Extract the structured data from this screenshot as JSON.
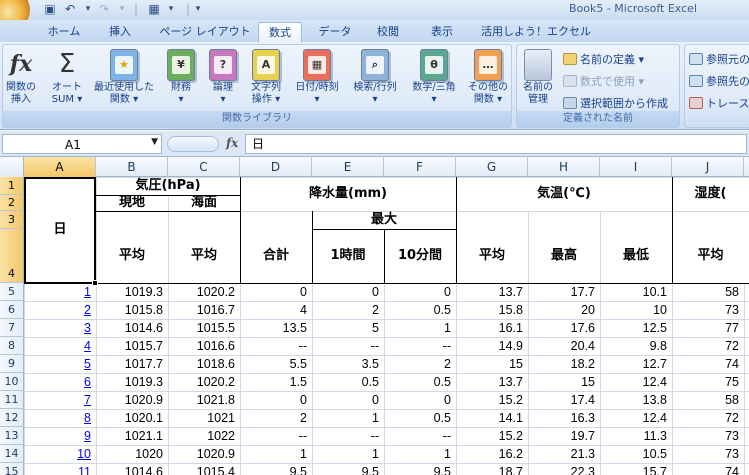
{
  "window": {
    "title": "Book5 - Microsoft Excel"
  },
  "tabs": [
    {
      "label": "ホーム"
    },
    {
      "label": "挿入"
    },
    {
      "label": "ページ レイアウト"
    },
    {
      "label": "数式"
    },
    {
      "label": "データ"
    },
    {
      "label": "校閲"
    },
    {
      "label": "表示"
    },
    {
      "label": "活用しよう！エクセル"
    }
  ],
  "ribbon": {
    "library": {
      "label": "関数ライブラリ",
      "buttons": [
        {
          "line1": "関数の",
          "line2": "挿入",
          "icon": "fx-icon"
        },
        {
          "line1": "オート",
          "line2": "SUM ▾",
          "icon": "sigma-icon"
        },
        {
          "line1": "最近使用した",
          "line2": "関数 ▾",
          "icon": "star-book-icon"
        },
        {
          "line1": "財務",
          "line2": "▾",
          "icon": "finance-book-icon"
        },
        {
          "line1": "論理",
          "line2": "▾",
          "icon": "logic-book-icon"
        },
        {
          "line1": "文字列",
          "line2": "操作 ▾",
          "icon": "text-book-icon"
        },
        {
          "line1": "日付/時刻",
          "line2": "▾",
          "icon": "datetime-book-icon"
        },
        {
          "line1": "検索/行列",
          "line2": "▾",
          "icon": "lookup-book-icon"
        },
        {
          "line1": "数学/三角",
          "line2": "▾",
          "icon": "math-book-icon"
        },
        {
          "line1": "その他の",
          "line2": "関数 ▾",
          "icon": "more-book-icon"
        }
      ]
    },
    "names": {
      "label": "定義された名前",
      "manager_line1": "名前の",
      "manager_line2": "管理",
      "define_name": "名前の定義 ▾",
      "use_in_formula": "数式で使用 ▾",
      "create_from_selection": "選択範囲から作成"
    },
    "audit": {
      "trace_precedents": "参照元の",
      "trace_dependents": "参照先の",
      "remove_arrows": "トレース"
    }
  },
  "formula_bar": {
    "name_box": "A1",
    "fx": "fx",
    "content": "日"
  },
  "columns": [
    "A",
    "B",
    "C",
    "D",
    "E",
    "F",
    "G",
    "H",
    "I",
    "J"
  ],
  "rows": [
    "1",
    "2",
    "3",
    "4",
    "5",
    "6",
    "7",
    "8",
    "9",
    "10",
    "11",
    "12",
    "13",
    "14",
    "15"
  ],
  "headers": {
    "day": "日",
    "pressure": "気圧(hPa)",
    "local": "現地",
    "sea": "海面",
    "precip": "降水量(mm)",
    "max": "最大",
    "avg": "平均",
    "total": "合計",
    "hour1": "1時間",
    "min10": "10分間",
    "temp": "気温(℃)",
    "high": "最高",
    "low": "最低",
    "humidity": "湿度("
  },
  "table": [
    {
      "day": "1",
      "b": "1019.3",
      "c": "1020.2",
      "d": "0",
      "e": "0",
      "f": "0",
      "g": "13.7",
      "h": "17.7",
      "i": "10.1",
      "j": "58"
    },
    {
      "day": "2",
      "b": "1015.8",
      "c": "1016.7",
      "d": "4",
      "e": "2",
      "f": "0.5",
      "g": "15.8",
      "h": "20",
      "i": "10",
      "j": "73"
    },
    {
      "day": "3",
      "b": "1014.6",
      "c": "1015.5",
      "d": "13.5",
      "e": "5",
      "f": "1",
      "g": "16.1",
      "h": "17.6",
      "i": "12.5",
      "j": "77"
    },
    {
      "day": "4",
      "b": "1015.7",
      "c": "1016.6",
      "d": "--",
      "e": "--",
      "f": "--",
      "g": "14.9",
      "h": "20.4",
      "i": "9.8",
      "j": "72"
    },
    {
      "day": "5",
      "b": "1017.7",
      "c": "1018.6",
      "d": "5.5",
      "e": "3.5",
      "f": "2",
      "g": "15",
      "h": "18.2",
      "i": "12.7",
      "j": "74"
    },
    {
      "day": "6",
      "b": "1019.3",
      "c": "1020.2",
      "d": "1.5",
      "e": "0.5",
      "f": "0.5",
      "g": "13.7",
      "h": "15",
      "i": "12.4",
      "j": "75"
    },
    {
      "day": "7",
      "b": "1020.9",
      "c": "1021.8",
      "d": "0",
      "e": "0",
      "f": "0",
      "g": "15.2",
      "h": "17.4",
      "i": "13.8",
      "j": "58"
    },
    {
      "day": "8",
      "b": "1020.1",
      "c": "1021",
      "d": "2",
      "e": "1",
      "f": "0.5",
      "g": "14.1",
      "h": "16.3",
      "i": "12.4",
      "j": "72"
    },
    {
      "day": "9",
      "b": "1021.1",
      "c": "1022",
      "d": "--",
      "e": "--",
      "f": "--",
      "g": "15.2",
      "h": "19.7",
      "i": "11.3",
      "j": "73"
    },
    {
      "day": "10",
      "b": "1020",
      "c": "1020.9",
      "d": "1",
      "e": "1",
      "f": "1",
      "g": "16.2",
      "h": "21.3",
      "i": "10.5",
      "j": "73"
    },
    {
      "day": "11",
      "b": "1014.6",
      "c": "1015.4",
      "d": "9.5",
      "e": "9.5",
      "f": "9.5",
      "g": "18.7",
      "h": "22.3",
      "i": "15.7",
      "j": "74"
    }
  ]
}
